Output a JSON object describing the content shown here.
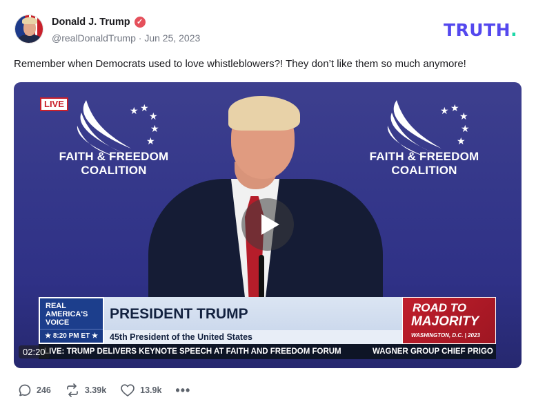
{
  "author": {
    "name": "Donald J. Trump",
    "handle": "@realDonaldTrump",
    "separator": "·",
    "date": "Jun 25, 2023",
    "verified_glyph": "✓"
  },
  "brand": {
    "logo_text": "TRUTH",
    "logo_dot": "."
  },
  "post": {
    "text": "Remember when Democrats used to love whistleblowers?! They don’t like them so much anymore!"
  },
  "video": {
    "live_tag": "LIVE",
    "backdrop_text": "FAITH & FREEDOM COALITION",
    "chyron": {
      "network_line1": "REAL",
      "network_line2": "AMERICA'S",
      "network_line3": "VOICE",
      "time": "★ 8:20 PM ET ★",
      "headline": "PRESIDENT TRUMP",
      "subline": "45th President of the United States",
      "side_line1": "ROAD TO",
      "side_line2": "MAJORITY",
      "side_line3": "WASHINGTON, D.C. | 2023",
      "ticker_1": "LIVE: TRUMP DELIVERS KEYNOTE SPEECH AT FAITH AND FREEDOM FORUM",
      "ticker_2": "WAGNER GROUP CHIEF PRIGO"
    },
    "duration": "02:20",
    "play_icon": "play-icon"
  },
  "actions": {
    "replies": "246",
    "retruths": "3.39k",
    "likes": "13.9k",
    "more": "•••"
  },
  "colors": {
    "logo": "#5448ee",
    "logo_dot": "#1ed8a8",
    "verified": "#e5505b",
    "action_text": "#5c626b"
  }
}
